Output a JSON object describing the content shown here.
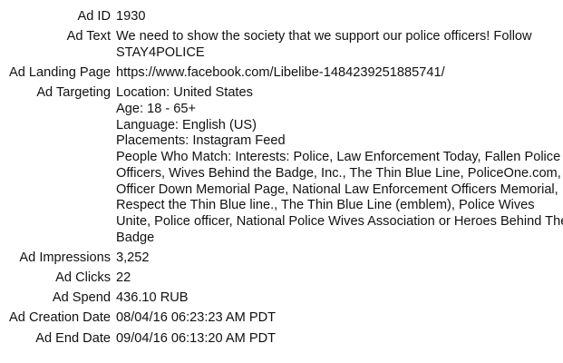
{
  "fields": [
    {
      "label": "Ad ID",
      "lines": [
        "1930"
      ]
    },
    {
      "label": "Ad Text",
      "lines": [
        "We need to show the society that we support our police officers! Follow",
        "STAY4POLICE"
      ]
    },
    {
      "label": "Ad Landing Page",
      "lines": [
        "https://www.facebook.com/Libelibe-1484239251885741/"
      ]
    },
    {
      "label": "Ad Targeting",
      "lines": [
        "Location: United States",
        "Age: 18 - 65+",
        "Language: English (US)",
        "Placements: Instagram Feed",
        "People Who Match: Interests: Police, Law Enforcement Today, Fallen Police",
        "Officers, Wives Behind the Badge, Inc., The Thin Blue Line, PoliceOne.com,",
        "Officer Down Memorial Page, National Law Enforcement Officers Memorial,",
        "Respect the Thin Blue line., The Thin Blue Line (emblem), Police Wives",
        "Unite, Police officer, National Police Wives Association or Heroes Behind The",
        "Badge"
      ]
    },
    {
      "label": "Ad Impressions",
      "lines": [
        "3,252"
      ]
    },
    {
      "label": "Ad Clicks",
      "lines": [
        "22"
      ]
    },
    {
      "label": "Ad Spend",
      "lines": [
        "436.10 RUB"
      ]
    },
    {
      "label": "Ad Creation Date",
      "lines": [
        "08/04/16 06:23:23 AM PDT"
      ]
    },
    {
      "label": "Ad End Date",
      "lines": [
        "09/04/16 06:13:20 AM PDT"
      ]
    }
  ]
}
